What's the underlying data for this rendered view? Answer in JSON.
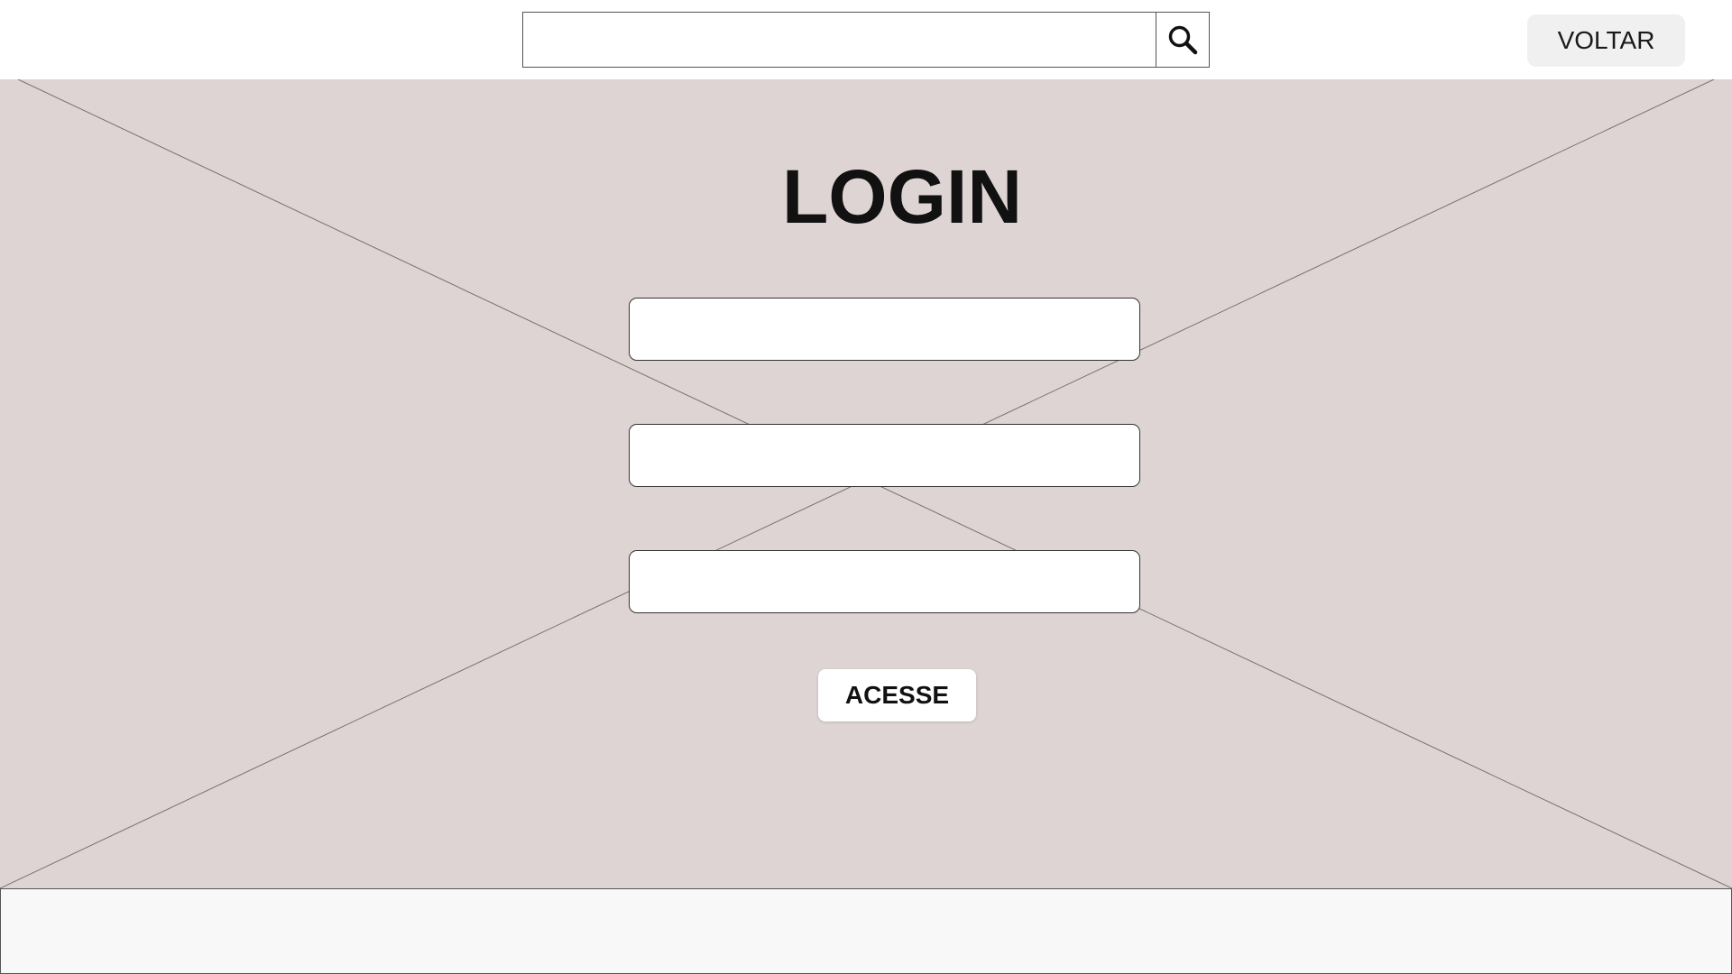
{
  "header": {
    "search": {
      "value": "",
      "placeholder": ""
    },
    "search_icon": "magnifier-icon",
    "back_label": "VOLTAR"
  },
  "main": {
    "title": "LOGIN",
    "fields": [
      {
        "value": "",
        "placeholder": ""
      },
      {
        "value": "",
        "placeholder": ""
      },
      {
        "value": "",
        "placeholder": ""
      }
    ],
    "submit_label": "ACESSE",
    "background_color": "#dfd4d4"
  },
  "footer": {
    "background_color": "#f8f8f8"
  }
}
